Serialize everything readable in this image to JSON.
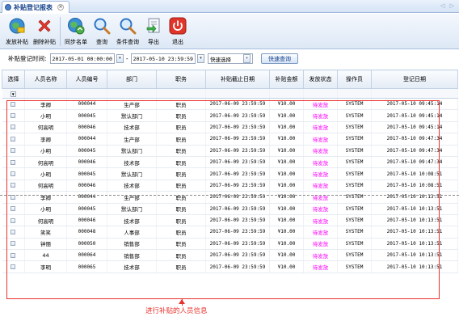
{
  "window": {
    "tab_title": "补贴登记报表",
    "close_glyph": "×",
    "nav_arrows": "◁ ▷"
  },
  "toolbar": [
    {
      "key": "issue",
      "label": "发放补贴",
      "icon": "globe-money-icon"
    },
    {
      "key": "delete",
      "label": "删除补贴",
      "icon": "red-x-icon"
    },
    {
      "key": "sync",
      "label": "同步名单",
      "icon": "globe-sync-icon"
    },
    {
      "key": "query",
      "label": "查询",
      "icon": "magnifier-icon"
    },
    {
      "key": "cond_query",
      "label": "条件查询",
      "icon": "magnifier-icon"
    },
    {
      "key": "export",
      "label": "导出",
      "icon": "export-icon"
    },
    {
      "key": "exit",
      "label": "退出",
      "icon": "power-icon"
    }
  ],
  "filter": {
    "label": "补贴登记时间:",
    "start": "2017-05-01 00:00:00",
    "separator": "-",
    "end": "2017-05-10 23:59:59",
    "quick_select": "快速选择",
    "quick_query": "快速查询",
    "dropdown_glyph": "▾"
  },
  "table": {
    "headers": [
      "选择",
      "人员名称",
      "人员编号",
      "部门",
      "职务",
      "补贴截止日期",
      "补贴金额",
      "发放状态",
      "操作员",
      "登记日期"
    ],
    "filter_glyph": "▼",
    "rows": [
      [
        "李卿",
        "000044",
        "生产部",
        "职员",
        "2017-06-09 23:59:59",
        "¥10.00",
        "待发放",
        "SYSTEM",
        "2017-05-10 09:45:14"
      ],
      [
        "小明",
        "000045",
        "默认部门",
        "职员",
        "2017-06-09 23:59:59",
        "¥10.00",
        "待发放",
        "SYSTEM",
        "2017-05-10 09:45:14"
      ],
      [
        "何高明",
        "000046",
        "技术部",
        "职员",
        "2017-06-09 23:59:59",
        "¥10.00",
        "待发放",
        "SYSTEM",
        "2017-05-10 09:45:14"
      ],
      [
        "李卿",
        "000044",
        "生产部",
        "职员",
        "2017-06-09 23:59:59",
        "¥10.00",
        "待发放",
        "SYSTEM",
        "2017-05-10 09:47:34"
      ],
      [
        "小明",
        "000045",
        "默认部门",
        "职员",
        "2017-06-09 23:59:59",
        "¥10.00",
        "待发放",
        "SYSTEM",
        "2017-05-10 09:47:34"
      ],
      [
        "何高明",
        "000046",
        "技术部",
        "职员",
        "2017-06-09 23:59:59",
        "¥10.00",
        "待发放",
        "SYSTEM",
        "2017-05-10 09:47:34"
      ],
      [
        "小明",
        "000045",
        "默认部门",
        "职员",
        "2017-06-09 23:59:59",
        "¥10.00",
        "待发放",
        "SYSTEM",
        "2017-05-10 10:08:51"
      ],
      [
        "何高明",
        "000046",
        "技术部",
        "职员",
        "2017-06-09 23:59:59",
        "¥10.00",
        "待发放",
        "SYSTEM",
        "2017-05-10 10:08:51"
      ],
      [
        "李卿",
        "000044",
        "生产部",
        "职员",
        "2017-06-09 23:59:59",
        "¥10.00",
        "待发放",
        "SYSTEM",
        "2017-05-10 10:13:51"
      ],
      [
        "小明",
        "000045",
        "默认部门",
        "职员",
        "2017-06-09 23:59:59",
        "¥10.00",
        "待发放",
        "SYSTEM",
        "2017-05-10 10:13:51"
      ],
      [
        "何高明",
        "000046",
        "技术部",
        "职员",
        "2017-06-09 23:59:59",
        "¥10.00",
        "待发放",
        "SYSTEM",
        "2017-05-10 10:13:51"
      ],
      [
        "笑笑",
        "000048",
        "人事部",
        "职员",
        "2017-06-09 23:59:59",
        "¥10.00",
        "待发放",
        "SYSTEM",
        "2017-05-10 10:13:51"
      ],
      [
        "钟丽",
        "000050",
        "销售部",
        "职员",
        "2017-06-09 23:59:59",
        "¥10.00",
        "待发放",
        "SYSTEM",
        "2017-05-10 10:13:51"
      ],
      [
        "44",
        "000064",
        "销售部",
        "职员",
        "2017-06-09 23:59:59",
        "¥10.00",
        "待发放",
        "SYSTEM",
        "2017-05-10 10:13:51"
      ],
      [
        "李明",
        "000065",
        "技术部",
        "职员",
        "2017-06-09 23:59:59",
        "¥10.00",
        "待发放",
        "SYSTEM",
        "2017-05-10 10:13:51"
      ]
    ]
  },
  "annotation": "进行补贴的人员信息",
  "colors": {
    "status": "#ff00ff",
    "highlight_box": "#e8322c",
    "header_blue": "#15428b"
  }
}
